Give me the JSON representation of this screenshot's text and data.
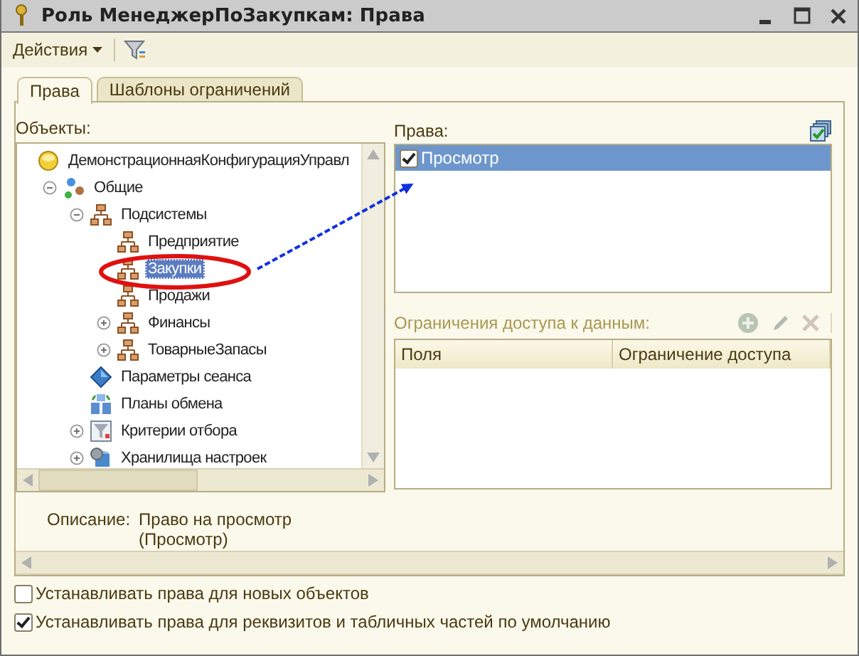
{
  "window": {
    "title": "Роль МенеджерПоЗакупкам: Права"
  },
  "toolbar": {
    "menu": "Действия"
  },
  "tabs": [
    {
      "label": "Права",
      "selected": true
    },
    {
      "label": "Шаблоны ограничений",
      "selected": false
    }
  ],
  "objects": {
    "label": "Объекты:",
    "tree": [
      {
        "label": "ДемонстрационнаяКонфигурацияУправл",
        "kind": "config",
        "selected": false,
        "children": [
          {
            "label": "Общие",
            "kind": "common",
            "selected": false,
            "expanded": true,
            "children": [
              {
                "label": "Подсистемы",
                "kind": "subsystem",
                "selected": false,
                "expanded": true,
                "children": [
                  {
                    "label": "Предприятие",
                    "kind": "subsystem",
                    "selected": false
                  },
                  {
                    "label": "Закупки",
                    "kind": "subsystem",
                    "selected": true
                  },
                  {
                    "label": "Продажи",
                    "kind": "subsystem",
                    "selected": false
                  },
                  {
                    "label": "Финансы",
                    "kind": "subsystem",
                    "selected": false,
                    "expanded": false
                  },
                  {
                    "label": "ТоварныеЗапасы",
                    "kind": "subsystem",
                    "selected": false,
                    "expanded": false
                  }
                ]
              },
              {
                "label": "Параметры сеанса",
                "kind": "session",
                "selected": false
              },
              {
                "label": "Планы обмена",
                "kind": "exchange",
                "selected": false
              },
              {
                "label": "Критерии отбора",
                "kind": "filter",
                "selected": false,
                "expanded": false
              },
              {
                "label": "Хранилища настроек",
                "kind": "storage",
                "selected": false,
                "expanded": false
              }
            ]
          }
        ]
      }
    ]
  },
  "rights": {
    "label": "Права:",
    "items": [
      {
        "label": "Просмотр",
        "checked": true,
        "selected": true
      }
    ]
  },
  "restrictions": {
    "label": "Ограничения доступа к данным:",
    "columns": [
      "Поля",
      "Ограничение доступа"
    ]
  },
  "description": {
    "label": "Описание:",
    "text": "Право на просмотр\n(Просмотр)"
  },
  "options": [
    {
      "label": "Устанавливать права для новых объектов",
      "checked": false
    },
    {
      "label": "Устанавливать права для реквизитов и табличных частей по умолчанию",
      "checked": true
    }
  ]
}
